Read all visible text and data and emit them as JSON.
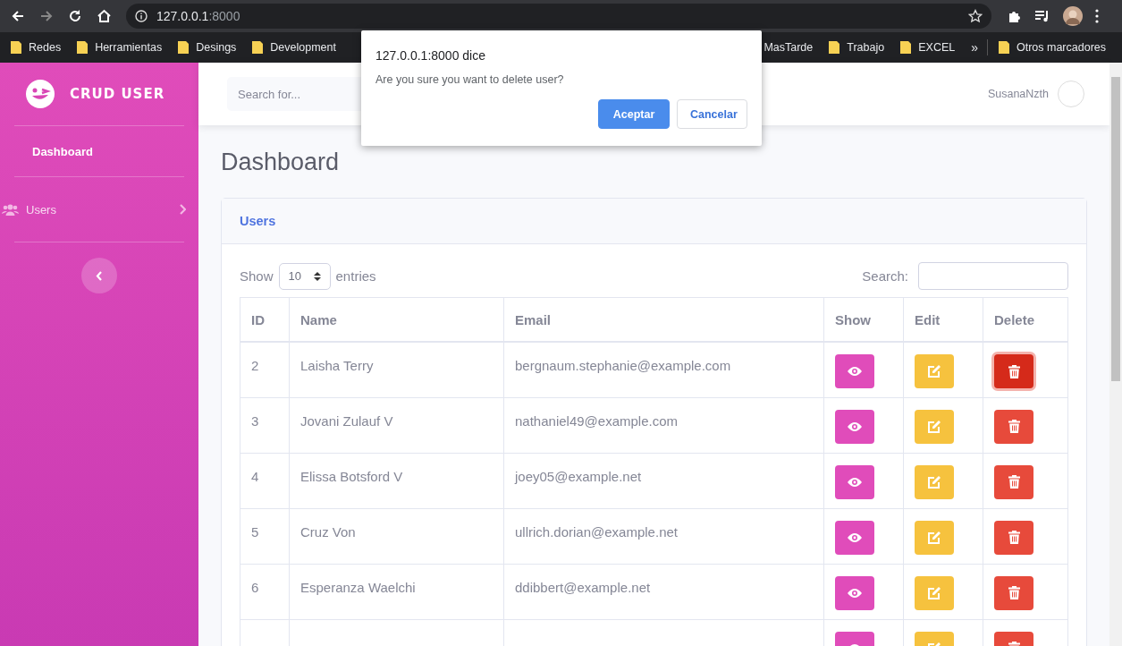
{
  "browser": {
    "url_host": "127.0.0.1",
    "url_port": ":8000",
    "bookmarks": [
      "Redes",
      "Herramientas",
      "Desings",
      "Development",
      "MasTarde",
      "Trabajo",
      "EXCEL"
    ],
    "overflow": "»",
    "other_bookmarks": "Otros marcadores"
  },
  "sidebar": {
    "brand": "CRUD USER",
    "items": [
      {
        "label": "Dashboard",
        "kind": "link",
        "selected": true
      },
      {
        "label": "Users",
        "kind": "collapse",
        "selected": false
      }
    ]
  },
  "topbar": {
    "search": {
      "placeholder": "Search for..."
    },
    "user": "SusanaNzth"
  },
  "page_title": "Dashboard",
  "card": {
    "title": "Users",
    "length": {
      "before": "Show",
      "value": "10",
      "after": "entries"
    },
    "search_label": "Search:",
    "columns": [
      "ID",
      "Name",
      "Email",
      "Show",
      "Edit",
      "Delete"
    ],
    "rows": [
      {
        "id": "2",
        "name": "Laisha Terry",
        "email": "bergnaum.stephanie@example.com",
        "delete_focused": true
      },
      {
        "id": "3",
        "name": "Jovani Zulauf V",
        "email": "nathaniel49@example.com",
        "delete_focused": false
      },
      {
        "id": "4",
        "name": "Elissa Botsford V",
        "email": "joey05@example.net",
        "delete_focused": false
      },
      {
        "id": "5",
        "name": "Cruz Von",
        "email": "ullrich.dorian@example.net",
        "delete_focused": false
      },
      {
        "id": "6",
        "name": "Esperanza Waelchi",
        "email": "ddibbert@example.net",
        "delete_focused": false
      },
      {
        "delete_focused": false
      }
    ]
  },
  "dialog": {
    "title": "127.0.0.1:8000 dice",
    "message": "Are you sure you want to delete user?",
    "buttons": [
      {
        "label": "Aceptar",
        "kind": "primary"
      },
      {
        "label": "Cancelar",
        "kind": "secondary"
      }
    ]
  }
}
